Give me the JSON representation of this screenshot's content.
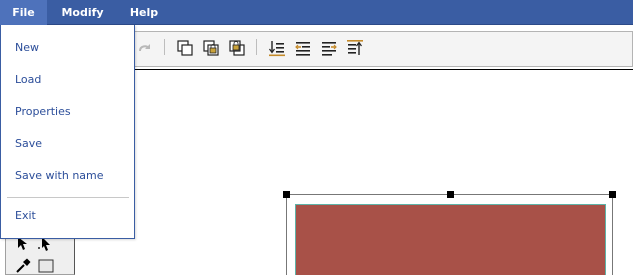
{
  "menubar": {
    "items": [
      {
        "label": "File",
        "active": true
      },
      {
        "label": "Modify",
        "active": false
      },
      {
        "label": "Help",
        "active": false
      }
    ]
  },
  "file_menu": {
    "items": [
      {
        "label": "New"
      },
      {
        "label": "Load"
      },
      {
        "label": "Properties"
      },
      {
        "label": "Save"
      },
      {
        "label": "Save with name"
      },
      {
        "label": "Exit"
      }
    ]
  },
  "toolbar": {
    "buttons": [
      {
        "icon": "redo-icon",
        "enabled": false
      },
      {
        "icon": "bring-to-front-icon",
        "enabled": true
      },
      {
        "icon": "lock-front-icon",
        "enabled": true
      },
      {
        "icon": "lock-back-icon",
        "enabled": true
      },
      {
        "icon": "align-bottom-icon",
        "enabled": true
      },
      {
        "icon": "align-left-icon",
        "enabled": true
      },
      {
        "icon": "align-right-icon",
        "enabled": true
      },
      {
        "icon": "align-top-icon",
        "enabled": true
      }
    ]
  },
  "palette": {
    "tools": [
      {
        "icon": "select-arrow-icon"
      },
      {
        "icon": "direct-select-arrow-icon"
      },
      {
        "icon": "eyedropper-icon"
      },
      {
        "icon": "rectangle-tool-icon"
      }
    ]
  },
  "canvas": {
    "selected_shape": {
      "type": "rectangle",
      "fill": "#a85148",
      "stroke": "#5fb3a8"
    }
  },
  "colors": {
    "menubar_bg": "#3a5da3",
    "menu_text": "#2c4e9a",
    "shape_fill": "#a85148"
  }
}
